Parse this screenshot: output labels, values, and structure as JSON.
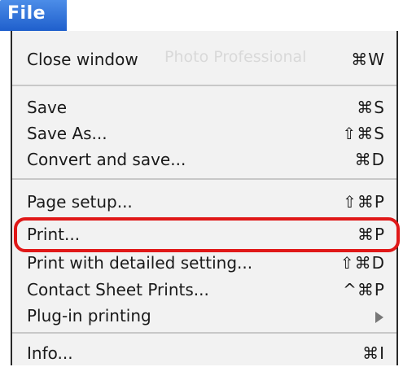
{
  "menu_title": "File",
  "watermark": "Photo Professional",
  "items": [
    {
      "label": "Close window",
      "shortcut": "⌘W"
    },
    {
      "label": "Save",
      "shortcut": "⌘S"
    },
    {
      "label": "Save As...",
      "shortcut": "⇧⌘S"
    },
    {
      "label": "Convert and save...",
      "shortcut": "⌘D"
    },
    {
      "label": "Page setup...",
      "shortcut": "⇧⌘P"
    },
    {
      "label": "Print...",
      "shortcut": "⌘P"
    },
    {
      "label": "Print with detailed setting...",
      "shortcut": "⇧⌘D"
    },
    {
      "label": "Contact Sheet Prints...",
      "shortcut": "^⌘P"
    },
    {
      "label": "Plug-in printing",
      "shortcut": ""
    },
    {
      "label": "Info...",
      "shortcut": "⌘I"
    }
  ],
  "highlight_color": "#e01818",
  "menu_bar_color": "#2f70d8",
  "icons": {
    "submenu": "chevron-right-icon"
  }
}
